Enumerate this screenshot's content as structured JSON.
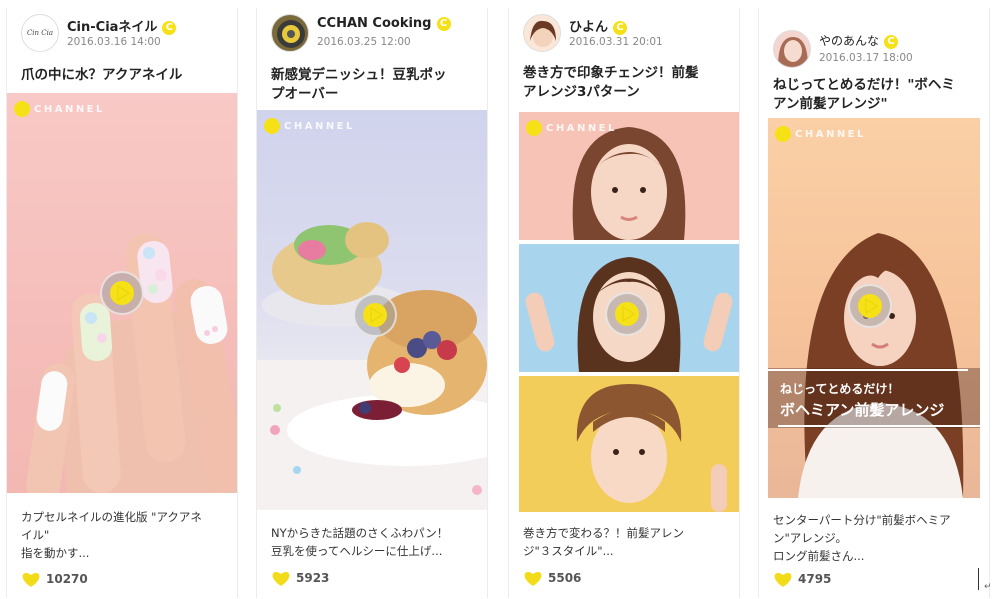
{
  "cards": [
    {
      "author": "Cin-Ciaネイル",
      "avatar_text": "Cin Cia",
      "badge": "C",
      "date": "2016.03.16 14:00",
      "title": "爪の中に水？アクアネイル",
      "logo_text": "CHANNEL",
      "desc_line1": "カプセルネイルの進化版 \"アクアネ",
      "desc_line2": "イル\"",
      "desc_line3": "指を動かす...",
      "likes": "10270"
    },
    {
      "author": "CCHAN Cooking",
      "badge": "C",
      "date": "2016.03.25 12:00",
      "title_line1": "新感覚デニッシュ！豆乳ポッ",
      "title_line2": "プオーバー",
      "logo_text": "CHANNEL",
      "desc_line1": "NYからきた話題のさくふわパン！",
      "desc_line2": "豆乳を使ってヘルシーに仕上げ...",
      "likes": "5923"
    },
    {
      "author": "ひよん",
      "badge": "C",
      "date": "2016.03.31 20:01",
      "title_line1": "巻き方で印象チェンジ！前髪",
      "title_line2": "アレンジ3パターン",
      "logo_text": "CHANNEL",
      "desc_line1": "巻き方で変わる？！前髪アレン",
      "desc_line2": "ジ\"３スタイル\"...",
      "likes": "5506"
    },
    {
      "author": "やのあんな",
      "badge": "C",
      "date": "2016.03.17 18:00",
      "title_line1": "ねじってとめるだけ！\"ボヘミ",
      "title_line2": "アン前髪アレンジ\"",
      "logo_text": "CHANNEL",
      "overlay_line1": "ねじってとめるだけ！",
      "overlay_line2": "ボヘミアン前髪アレンジ",
      "desc_line1": "センターパート分け\"前髪ボヘミア",
      "desc_line2": "ン\"アレンジ。",
      "desc_line3": "ロング前髪さん...",
      "likes": "4795"
    }
  ],
  "colors": {
    "accent": "#f6e117",
    "heart": "#f2dc1a"
  }
}
